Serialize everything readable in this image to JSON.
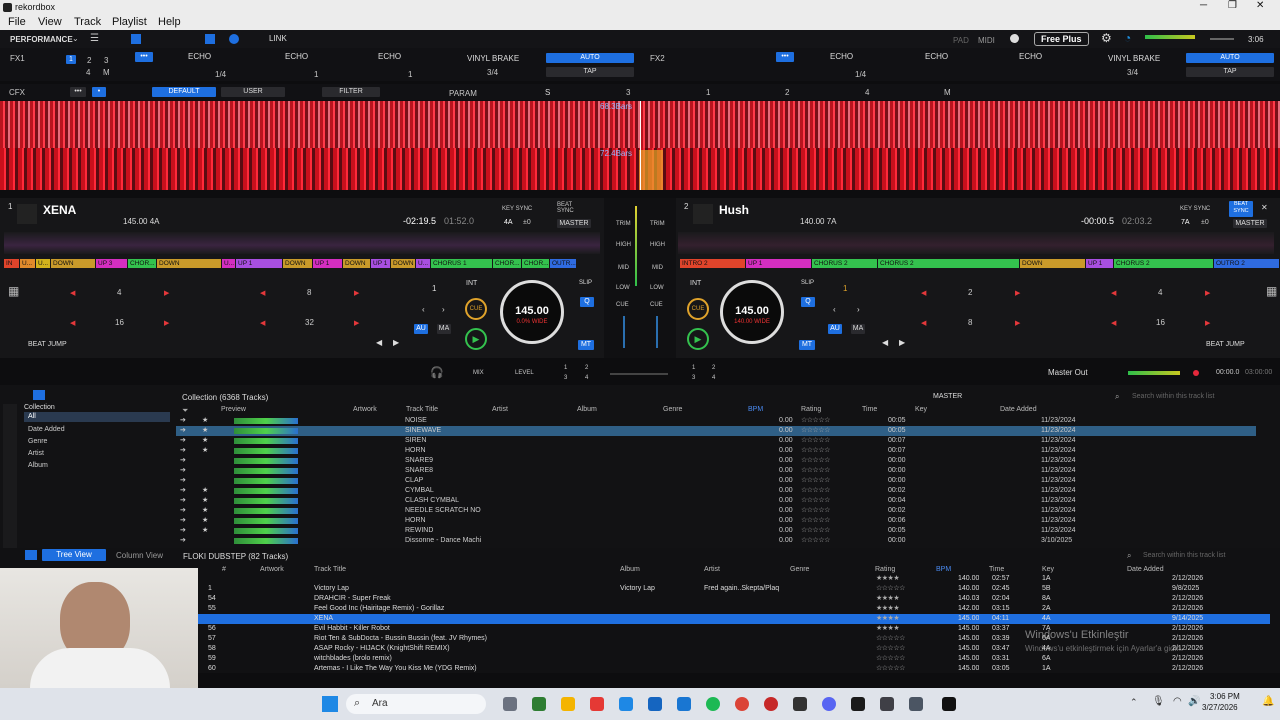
{
  "app": {
    "title": "rekordbox"
  },
  "menu": [
    "File",
    "View",
    "Track",
    "Playlist",
    "Help"
  ],
  "toolbar": {
    "mode": "PERFORMANCE",
    "link": "LINK",
    "pad": "PAD",
    "midi": "MIDI",
    "free_plus": "Free Plus",
    "time": "3:06"
  },
  "fx1": {
    "label": "FX1",
    "slots": [
      "ECHO",
      "ECHO",
      "ECHO"
    ],
    "beat": "1/4",
    "vinyl": "VINYL BRAKE",
    "beat2": "3/4",
    "auto": "AUTO",
    "tap": "TAP",
    "nums": [
      "1",
      "2",
      "3",
      "4",
      "M"
    ],
    "vals": [
      "1",
      "1",
      "1"
    ]
  },
  "fx2": {
    "label": "FX2",
    "slots": [
      "ECHO",
      "ECHO",
      "ECHO"
    ],
    "beat": "1/4",
    "vinyl": "VINYL BRAKE",
    "beat2": "3/4",
    "auto": "AUTO",
    "tap": "TAP",
    "vals": [
      "1",
      "1",
      "1"
    ]
  },
  "cfx": {
    "label": "CFX",
    "default": "DEFAULT",
    "user": "USER",
    "filter": "FILTER",
    "param": "PARAM",
    "s": "S",
    "vals": [
      "3",
      "1",
      "2",
      "4",
      "M"
    ]
  },
  "waveforms": {
    "bars1": "68.3Bars",
    "bars2": "72.4Bars"
  },
  "deck1": {
    "num": "1",
    "title": "XENA",
    "bpm_key": "145.00 4A",
    "remain": "-02:19.5",
    "total": "01:52.0",
    "key_sync": "KEY SYNC",
    "beat_sync": "BEAT SYNC",
    "key": "4A",
    "pm": "±0",
    "master": "MASTER",
    "int": "INT",
    "cue": "CUE",
    "q": "Q",
    "au": "AU",
    "ma": "MA",
    "mt": "MT",
    "slip": "SLIP",
    "jog_bpm": "145.00",
    "jog_sub": "0.0% WIDE",
    "beat_jump": "BEAT JUMP",
    "jump_vals": [
      "4",
      "8",
      "16",
      "32"
    ],
    "loop": "1",
    "cues": [
      {
        "t": "IN",
        "c": "#e0442b",
        "w": 16
      },
      {
        "t": "U...",
        "c": "#e08a2b",
        "w": 16
      },
      {
        "t": "U...",
        "c": "#d2b21c",
        "w": 15
      },
      {
        "t": "DOWN",
        "c": "#c99a2a",
        "w": 45
      },
      {
        "t": "UP 3",
        "c": "#d42ec0",
        "w": 32
      },
      {
        "t": "CHOR...",
        "c": "#34c24e",
        "w": 29
      },
      {
        "t": "DOWN",
        "c": "#c99a2a",
        "w": 65
      },
      {
        "t": "U...",
        "c": "#d42ec0",
        "w": 14
      },
      {
        "t": "UP 1",
        "c": "#a84fe0",
        "w": 47
      },
      {
        "t": "DOWN",
        "c": "#c99a2a",
        "w": 30
      },
      {
        "t": "UP 1",
        "c": "#d42ec0",
        "w": 30
      },
      {
        "t": "DOWN",
        "c": "#c99a2a",
        "w": 28
      },
      {
        "t": "UP 1",
        "c": "#a84fe0",
        "w": 20
      },
      {
        "t": "DOWN",
        "c": "#c99a2a",
        "w": 25
      },
      {
        "t": "U...",
        "c": "#a84fe0",
        "w": 15
      },
      {
        "t": "CHORUS 1",
        "c": "#34c24e",
        "w": 62
      },
      {
        "t": "CHOR...",
        "c": "#34c24e",
        "w": 29
      },
      {
        "t": "CHOR...",
        "c": "#34c24e",
        "w": 28
      },
      {
        "t": "OUTR...",
        "c": "#2f6be0",
        "w": 27
      }
    ]
  },
  "deck2": {
    "num": "2",
    "title": "Hush",
    "bpm_key": "140.00 7A",
    "remain": "-00:00.5",
    "total": "02:03.2",
    "key_sync": "KEY SYNC",
    "beat_sync": "BEAT SYNC",
    "key": "7A",
    "pm": "±0",
    "master": "MASTER",
    "int": "INT",
    "cue": "CUE",
    "q": "Q",
    "au": "AU",
    "ma": "MA",
    "mt": "MT",
    "slip": "SLIP",
    "jog_bpm": "145.00",
    "jog_sub": "140.00 WIDE",
    "beat_jump": "BEAT JUMP",
    "jump_vals": [
      "2",
      "4",
      "8",
      "16"
    ],
    "loop": "1",
    "cues": [
      {
        "t": "INTRO 2",
        "c": "#e0442b",
        "w": 66
      },
      {
        "t": "UP 1",
        "c": "#d42ec0",
        "w": 66
      },
      {
        "t": "CHORUS 2",
        "c": "#34c24e",
        "w": 66
      },
      {
        "t": "CHORUS 2",
        "c": "#34c24e",
        "w": 142
      },
      {
        "t": "DOWN",
        "c": "#c99a2a",
        "w": 66
      },
      {
        "t": "UP 1",
        "c": "#a84fe0",
        "w": 28
      },
      {
        "t": "CHORUS 2",
        "c": "#34c24e",
        "w": 100
      },
      {
        "t": "OUTRO 2",
        "c": "#2f6be0",
        "w": 66
      }
    ]
  },
  "mixer": {
    "trim": "TRIM",
    "high": "HIGH",
    "mid": "MID",
    "low": "LOW",
    "cue": "CUE",
    "mix": "MIX",
    "level": "LEVEL",
    "master_out": "Master Out",
    "time1": "00:00.0",
    "time2": "03:00:00",
    "ch": [
      "1",
      "2",
      "3",
      "4"
    ]
  },
  "browser": {
    "collection_header": "Collection (6368 Tracks)",
    "master": "MASTER",
    "search": "Search within this track list",
    "tree": [
      "Collection",
      "All",
      "Date Added",
      "Genre",
      "Artist",
      "Album"
    ],
    "cols": [
      "Preview",
      "Artwork",
      "Track Title",
      "Artist",
      "Album",
      "Genre",
      "BPM",
      "Rating",
      "Time",
      "Key",
      "Date Added"
    ],
    "rows": [
      {
        "title": "NOISE",
        "bpm": "0.00",
        "time": "00:05",
        "date": "11/23/2024",
        "star": true
      },
      {
        "title": "SINEWAVE",
        "bpm": "0.00",
        "time": "00:05",
        "date": "11/23/2024",
        "star": true
      },
      {
        "title": "SIREN",
        "bpm": "0.00",
        "time": "00:07",
        "date": "11/23/2024",
        "star": true
      },
      {
        "title": "HORN",
        "bpm": "0.00",
        "time": "00:07",
        "date": "11/23/2024",
        "star": true
      },
      {
        "title": "SNARE9",
        "bpm": "0.00",
        "time": "00:00",
        "date": "11/23/2024",
        "star": false
      },
      {
        "title": "SNARE8",
        "bpm": "0.00",
        "time": "00:00",
        "date": "11/23/2024",
        "star": false
      },
      {
        "title": "CLAP",
        "bpm": "0.00",
        "time": "00:00",
        "date": "11/23/2024",
        "star": false
      },
      {
        "title": "CYMBAL",
        "bpm": "0.00",
        "time": "00:02",
        "date": "11/23/2024",
        "star": true
      },
      {
        "title": "CLASH CYMBAL",
        "bpm": "0.00",
        "time": "00:04",
        "date": "11/23/2024",
        "star": true
      },
      {
        "title": "NEEDLE SCRATCH NO",
        "bpm": "0.00",
        "time": "00:02",
        "date": "11/23/2024",
        "star": true
      },
      {
        "title": "HORN",
        "bpm": "0.00",
        "time": "00:06",
        "date": "11/23/2024",
        "star": true
      },
      {
        "title": "REWIND",
        "bpm": "0.00",
        "time": "00:05",
        "date": "11/23/2024",
        "star": true
      },
      {
        "title": "Dissonne - Dance Machi",
        "bpm": "0.00",
        "time": "00:00",
        "date": "3/10/2025",
        "star": false
      }
    ]
  },
  "playlist": {
    "tree_view": "Tree View",
    "column_view": "Column View",
    "header": "FLOKI DUBSTEP (82 Tracks)",
    "search": "Search within this track list",
    "cols": [
      "#",
      "Artwork",
      "Track Title",
      "Album",
      "Artist",
      "Genre",
      "Rating",
      "BPM",
      "Time",
      "Key",
      "Date Added"
    ],
    "rows": [
      {
        "n": "",
        "title": "",
        "album": "",
        "artist": "",
        "stars": "★★★★",
        "bpm": "140.00",
        "time": "02:57",
        "key": "1A",
        "date": "2/12/2026"
      },
      {
        "n": "1",
        "title": "Victory Lap",
        "album": "Victory Lap",
        "artist": "Fred again..Skepta/Plaq",
        "stars": "☆☆☆☆☆",
        "bpm": "140.00",
        "time": "02:45",
        "key": "5B",
        "date": "9/8/2025"
      },
      {
        "n": "54",
        "title": "DRAHCIR - Super Freak",
        "album": "",
        "artist": "",
        "stars": "★★★★",
        "bpm": "140.03",
        "time": "02:04",
        "key": "8A",
        "date": "2/12/2026"
      },
      {
        "n": "55",
        "title": "Feel Good Inc (Hairitage Remix) - Gorillaz",
        "album": "",
        "artist": "",
        "stars": "★★★★",
        "bpm": "142.00",
        "time": "03:15",
        "key": "2A",
        "date": "2/12/2026"
      },
      {
        "n": "",
        "title": "XENA",
        "album": "",
        "artist": "",
        "stars": "★★★★",
        "bpm": "145.00",
        "time": "04:11",
        "key": "4A",
        "date": "9/14/2025",
        "sel": true
      },
      {
        "n": "56",
        "title": "Evil Habbit - Killer Robot",
        "album": "",
        "artist": "",
        "stars": "★★★★",
        "bpm": "145.00",
        "time": "03:37",
        "key": "7A",
        "date": "2/12/2026"
      },
      {
        "n": "57",
        "title": "Riot Ten & SubDocta - Bussin Bussin (feat. JV Rhymes)",
        "album": "",
        "artist": "",
        "stars": "☆☆☆☆☆",
        "bpm": "145.00",
        "time": "03:39",
        "key": "6A",
        "date": "2/12/2026"
      },
      {
        "n": "58",
        "title": "ASAP Rocky - HIJACK (KnightShift REMIX)",
        "album": "",
        "artist": "",
        "stars": "☆☆☆☆☆",
        "bpm": "145.00",
        "time": "03:47",
        "key": "4A",
        "date": "2/12/2026"
      },
      {
        "n": "59",
        "title": "witchblades (brolo remix)",
        "album": "",
        "artist": "",
        "stars": "☆☆☆☆☆",
        "bpm": "145.00",
        "time": "03:31",
        "key": "6A",
        "date": "2/12/2026"
      },
      {
        "n": "60",
        "title": "Artemas - I Like The Way You Kiss Me (YDG Remix)",
        "album": "",
        "artist": "",
        "stars": "☆☆☆☆☆",
        "bpm": "145.00",
        "time": "03:05",
        "key": "1A",
        "date": "2/12/2026"
      }
    ]
  },
  "watermark": {
    "l1": "Windows'u Etkinleştir",
    "l2": "Windows'u etkinleştirmek için Ayarlar'a gidin."
  },
  "taskbar": {
    "search": "Ara",
    "time": "3:06 PM",
    "date": "3/27/2026"
  },
  "colors": {
    "accent": "#1e6fe0",
    "wave_red": "#e5283b"
  }
}
